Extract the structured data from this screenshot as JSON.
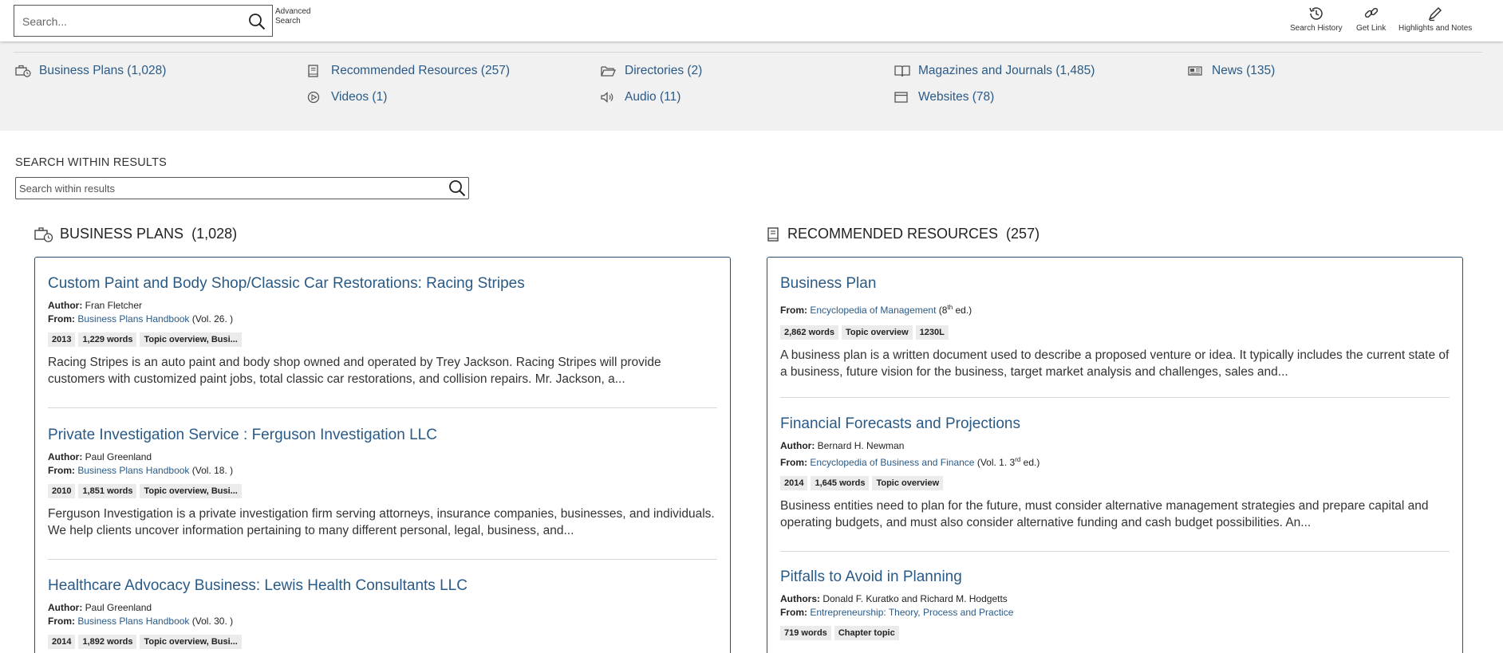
{
  "topbar": {
    "search_placeholder": "Search...",
    "advanced_search": "Advanced Search",
    "tools": [
      {
        "label": "Search History",
        "icon": "history-icon"
      },
      {
        "label": "Get Link",
        "icon": "link-icon"
      },
      {
        "label": "Highlights and Notes",
        "icon": "pen-icon"
      }
    ]
  },
  "content_types": [
    {
      "label": "Business Plans (1,028)",
      "icon": "briefcase-clock-icon"
    },
    {
      "label": "Recommended Resources (257)",
      "icon": "book-icon"
    },
    {
      "label": "Directories (2)",
      "icon": "folder-icon"
    },
    {
      "label": "Magazines and Journals (1,485)",
      "icon": "open-book-icon"
    },
    {
      "label": "News (135)",
      "icon": "newspaper-icon"
    },
    {
      "label": "Videos (1)",
      "icon": "play-icon"
    },
    {
      "label": "Audio (11)",
      "icon": "speaker-icon"
    },
    {
      "label": "Websites (78)",
      "icon": "browser-icon"
    }
  ],
  "search_within": {
    "label": "SEARCH WITHIN RESULTS",
    "placeholder": "Search within results"
  },
  "business_plans": {
    "title": "BUSINESS PLANS",
    "count": "(1,028)",
    "items": [
      {
        "title": "Custom Paint and Body Shop/Classic Car Restorations: Racing Stripes",
        "author_label": "Author:",
        "author": "Fran Fletcher",
        "from_label": "From:",
        "source": "Business Plans Handbook",
        "source_extra": " (Vol. 26. )",
        "tags": [
          "2013",
          "1,229 words",
          "Topic overview, Busi..."
        ],
        "description": "Racing Stripes is an auto paint and body shop owned and operated by Trey Jackson. Racing Stripes will provide customers with customized paint jobs, total classic car restorations, and collision repairs. Mr. Jackson, a..."
      },
      {
        "title": "Private Investigation Service : Ferguson Investigation LLC",
        "author_label": "Author:",
        "author": "Paul Greenland",
        "from_label": "From:",
        "source": "Business Plans Handbook",
        "source_extra": " (Vol. 18. )",
        "tags": [
          "2010",
          "1,851 words",
          "Topic overview, Busi..."
        ],
        "description": "Ferguson Investigation is a private investigation firm serving attorneys, insurance companies, businesses, and individuals. We help clients uncover information pertaining to many different personal, legal, business, and..."
      },
      {
        "title": "Healthcare Advocacy Business: Lewis Health Consultants LLC",
        "author_label": "Author:",
        "author": "Paul Greenland",
        "from_label": "From:",
        "source": "Business Plans Handbook",
        "source_extra": " (Vol. 30. )",
        "tags": [
          "2014",
          "1,892 words",
          "Topic overview, Busi..."
        ],
        "description": ""
      }
    ]
  },
  "recommended": {
    "title": "RECOMMENDED RESOURCES",
    "count": "(257)",
    "items": [
      {
        "title": "Business Plan",
        "from_label": "From:",
        "source": "Encyclopedia of Management",
        "source_extra_pre": " (8",
        "source_sup": "th",
        "source_extra_post": " ed.)",
        "tags": [
          "2,862 words",
          "Topic overview",
          "1230L"
        ],
        "description": "A business plan is a written document used to describe a proposed venture or idea. It typically includes the current state of a business, future vision for the business, target market analysis and challenges, sales and..."
      },
      {
        "title": "Financial Forecasts and Projections",
        "author_label": "Author:",
        "author": "Bernard H. Newman",
        "from_label": "From:",
        "source": "Encyclopedia of Business and Finance",
        "source_extra_pre": " (Vol. 1. 3",
        "source_sup": "rd",
        "source_extra_post": " ed.)",
        "tags": [
          "2014",
          "1,645 words",
          "Topic overview"
        ],
        "description": "Business entities need to plan for the future, must consider alternative management strategies and prepare capital and operating budgets, and must also consider alternative funding and cash budget possibilities. An..."
      },
      {
        "title": "Pitfalls to Avoid in Planning",
        "author_label": "Authors:",
        "author": "Donald F. Kuratko and Richard M. Hodgetts",
        "from_label": "From:",
        "source": "Entrepreneurship: Theory, Process and Practice",
        "tags": [
          "719 words",
          "Chapter topic"
        ],
        "description": ""
      }
    ]
  }
}
